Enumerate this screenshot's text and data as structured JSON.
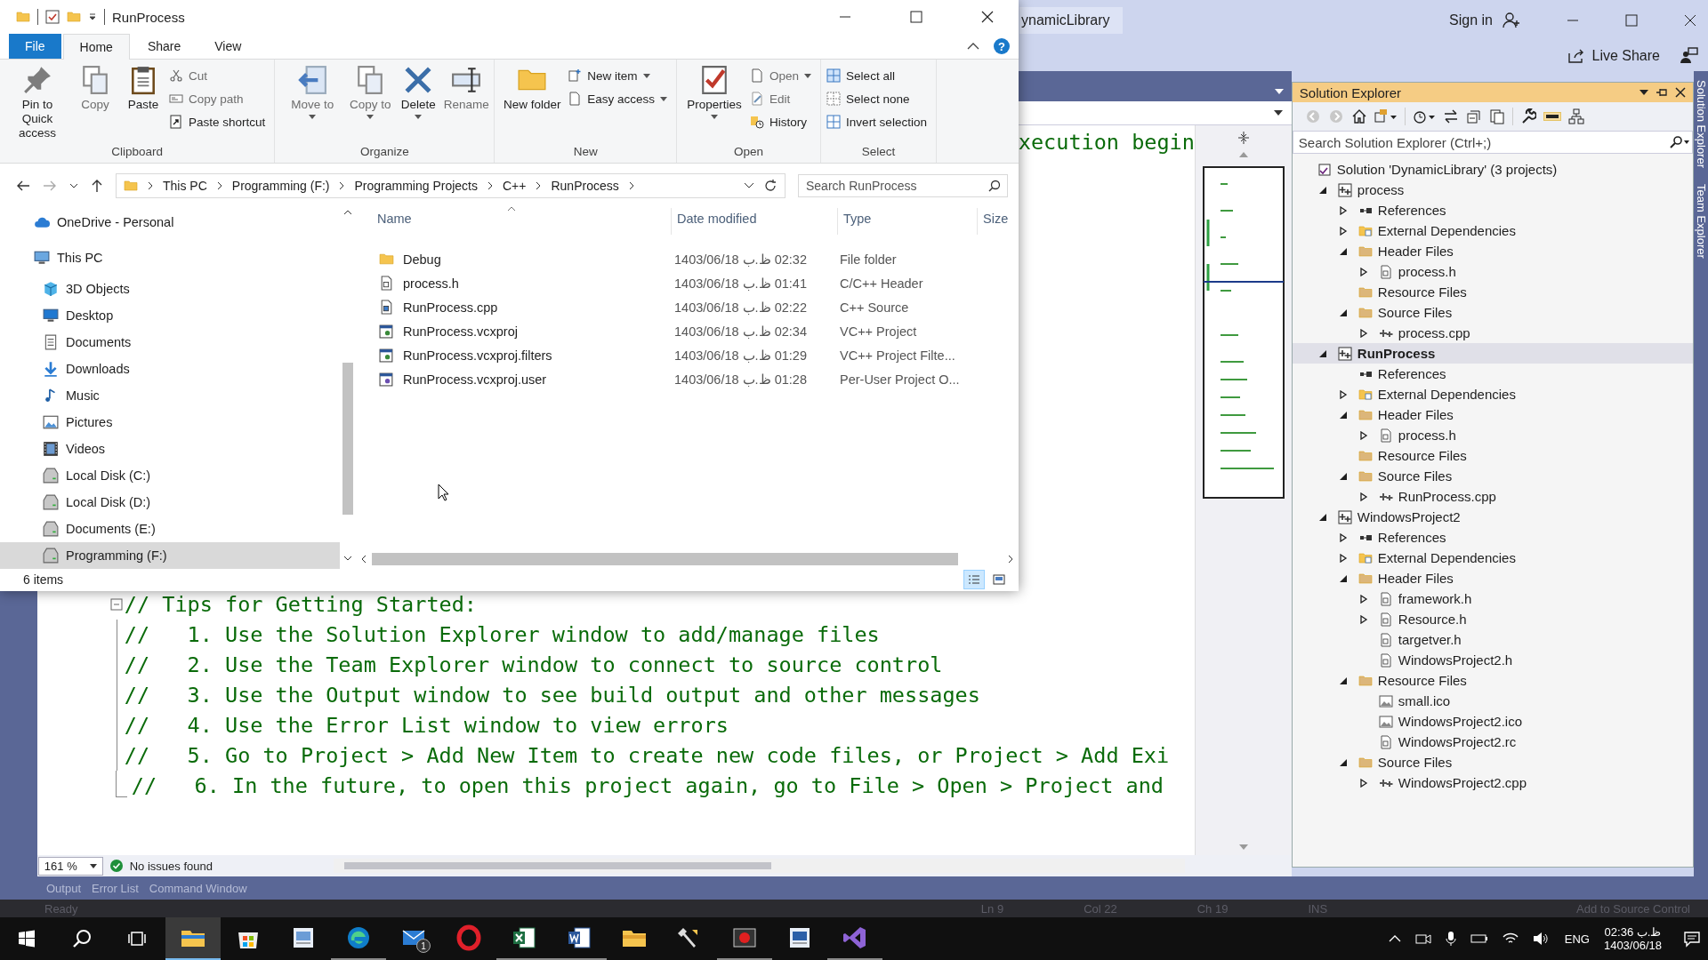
{
  "vs": {
    "title": "ynamicLibrary",
    "sign_in": "Sign in",
    "live_share": "Live Share",
    "editor": {
      "top_line": "xecution begin",
      "lines": [
        {
          "text": "// Tips for Getting Started:",
          "kind": "fold"
        },
        {
          "text": "//   1. Use the Solution Explorer window to add/manage files",
          "kind": "inner"
        },
        {
          "text": "//   2. Use the Team Explorer window to connect to source control",
          "kind": "inner"
        },
        {
          "text": "//   3. Use the Output window to see build output and other messages",
          "kind": "inner"
        },
        {
          "text": "//   4. Use the Error List window to view errors",
          "kind": "inner"
        },
        {
          "text": "//   5. Go to Project > Add New Item to create new code files, or Project > Add Exi",
          "kind": "inner"
        },
        {
          "text": "//   6. In the future, to open this project again, go to File > Open > Project and",
          "kind": "end"
        }
      ],
      "zoom": "161 %",
      "issues": "No issues found"
    },
    "solution_explorer": {
      "title": "Solution Explorer",
      "preview_toggle": {
        "on": true
      },
      "search": {
        "placeholder": "Search Solution Explorer (Ctrl+;)"
      },
      "tree": [
        {
          "label": "Solution 'DynamicLibrary' (3 projects)",
          "kind": "solution",
          "expandable": false,
          "selected": false,
          "children": [
            {
              "label": "process",
              "kind": "project",
              "expandable": true,
              "expanded": true,
              "selected": false,
              "children": [
                {
                  "label": "References",
                  "kind": "references",
                  "expandable": true,
                  "expanded": false,
                  "selected": false
                },
                {
                  "label": "External Dependencies",
                  "kind": "external",
                  "expandable": true,
                  "expanded": false,
                  "selected": false
                },
                {
                  "label": "Header Files",
                  "kind": "filter",
                  "expandable": true,
                  "expanded": true,
                  "selected": false,
                  "children": [
                    {
                      "label": "process.h",
                      "kind": "header",
                      "expandable": true,
                      "expanded": false,
                      "selected": false
                    }
                  ]
                },
                {
                  "label": "Resource Files",
                  "kind": "filter",
                  "expandable": false,
                  "selected": false
                },
                {
                  "label": "Source Files",
                  "kind": "filter",
                  "expandable": true,
                  "expanded": true,
                  "selected": false,
                  "children": [
                    {
                      "label": "process.cpp",
                      "kind": "source",
                      "expandable": true,
                      "expanded": false,
                      "selected": false
                    }
                  ]
                }
              ]
            },
            {
              "label": "RunProcess",
              "kind": "project",
              "expandable": true,
              "expanded": true,
              "selected": true,
              "children": [
                {
                  "label": "References",
                  "kind": "references",
                  "expandable": false,
                  "selected": false
                },
                {
                  "label": "External Dependencies",
                  "kind": "external",
                  "expandable": true,
                  "expanded": false,
                  "selected": false
                },
                {
                  "label": "Header Files",
                  "kind": "filter",
                  "expandable": true,
                  "expanded": true,
                  "selected": false,
                  "children": [
                    {
                      "label": "process.h",
                      "kind": "header",
                      "expandable": true,
                      "expanded": false,
                      "selected": false
                    }
                  ]
                },
                {
                  "label": "Resource Files",
                  "kind": "filter",
                  "expandable": false,
                  "selected": false
                },
                {
                  "label": "Source Files",
                  "kind": "filter",
                  "expandable": true,
                  "expanded": true,
                  "selected": false,
                  "children": [
                    {
                      "label": "RunProcess.cpp",
                      "kind": "source",
                      "expandable": true,
                      "expanded": false,
                      "selected": false
                    }
                  ]
                }
              ]
            },
            {
              "label": "WindowsProject2",
              "kind": "project",
              "expandable": true,
              "expanded": true,
              "selected": false,
              "children": [
                {
                  "label": "References",
                  "kind": "references",
                  "expandable": true,
                  "expanded": false,
                  "selected": false
                },
                {
                  "label": "External Dependencies",
                  "kind": "external",
                  "expandable": true,
                  "expanded": false,
                  "selected": false
                },
                {
                  "label": "Header Files",
                  "kind": "filter",
                  "expandable": true,
                  "expanded": true,
                  "selected": false,
                  "children": [
                    {
                      "label": "framework.h",
                      "kind": "header",
                      "expandable": true,
                      "expanded": false,
                      "selected": false
                    },
                    {
                      "label": "Resource.h",
                      "kind": "header",
                      "expandable": true,
                      "expanded": false,
                      "selected": false
                    },
                    {
                      "label": "targetver.h",
                      "kind": "header",
                      "expandable": false,
                      "selected": false
                    },
                    {
                      "label": "WindowsProject2.h",
                      "kind": "header",
                      "expandable": false,
                      "selected": false
                    }
                  ]
                },
                {
                  "label": "Resource Files",
                  "kind": "filter",
                  "expandable": true,
                  "expanded": true,
                  "selected": false,
                  "children": [
                    {
                      "label": "small.ico",
                      "kind": "image",
                      "expandable": false,
                      "selected": false
                    },
                    {
                      "label": "WindowsProject2.ico",
                      "kind": "image",
                      "expandable": false,
                      "selected": false
                    },
                    {
                      "label": "WindowsProject2.rc",
                      "kind": "resource",
                      "expandable": false,
                      "selected": false
                    }
                  ]
                },
                {
                  "label": "Source Files",
                  "kind": "filter",
                  "expandable": true,
                  "expanded": true,
                  "selected": false,
                  "children": [
                    {
                      "label": "WindowsProject2.cpp",
                      "kind": "source",
                      "expandable": true,
                      "expanded": false,
                      "selected": false
                    }
                  ]
                }
              ]
            }
          ]
        }
      ]
    },
    "side_tabs": [
      "Solution Explorer",
      "Team Explorer"
    ],
    "tool_tabs": [
      "Output",
      "Error List",
      "Command Window"
    ],
    "status_bar": {
      "state": "Ready",
      "line": "Ln 9",
      "col": "Col 22",
      "ch": "Ch 19",
      "mode": "INS",
      "source_control": "Add to Source Control"
    }
  },
  "explorer": {
    "title": "RunProcess",
    "help": "?",
    "ribbon_tabs": [
      {
        "label": "File",
        "kind": "file",
        "selected": false
      },
      {
        "label": "Home",
        "kind": "tab",
        "selected": true
      },
      {
        "label": "Share",
        "kind": "tab",
        "selected": false
      },
      {
        "label": "View",
        "kind": "tab",
        "selected": false
      }
    ],
    "ribbon_groups": [
      {
        "label": "Clipboard",
        "buttons": [
          {
            "label": "Pin to Quick access",
            "kind": "large",
            "disabled": false,
            "menu": false
          },
          {
            "label": "Copy",
            "kind": "large",
            "disabled": true,
            "menu": false
          },
          {
            "label": "Paste",
            "kind": "large",
            "disabled": false,
            "menu": false
          },
          {
            "label": "Cut",
            "kind": "small",
            "disabled": true,
            "menu": false
          },
          {
            "label": "Copy path",
            "kind": "small",
            "disabled": true,
            "menu": false
          },
          {
            "label": "Paste shortcut",
            "kind": "small",
            "disabled": false,
            "menu": false
          }
        ]
      },
      {
        "label": "Organize",
        "buttons": [
          {
            "label": "Move to",
            "kind": "large",
            "disabled": true,
            "menu": true
          },
          {
            "label": "Copy to",
            "kind": "large",
            "disabled": true,
            "menu": true
          },
          {
            "label": "Delete",
            "kind": "large",
            "disabled": false,
            "menu": true
          },
          {
            "label": "Rename",
            "kind": "large",
            "disabled": true,
            "menu": false
          }
        ]
      },
      {
        "label": "New",
        "buttons": [
          {
            "label": "New folder",
            "kind": "large",
            "disabled": false,
            "menu": false
          },
          {
            "label": "New item",
            "kind": "small",
            "disabled": false,
            "menu": true
          },
          {
            "label": "Easy access",
            "kind": "small",
            "disabled": false,
            "menu": true
          }
        ]
      },
      {
        "label": "Open",
        "buttons": [
          {
            "label": "Properties",
            "kind": "large",
            "disabled": false,
            "menu": true
          },
          {
            "label": "Open",
            "kind": "small",
            "disabled": true,
            "menu": true
          },
          {
            "label": "Edit",
            "kind": "small",
            "disabled": true,
            "menu": false
          },
          {
            "label": "History",
            "kind": "small",
            "disabled": false,
            "menu": false
          }
        ]
      },
      {
        "label": "Select",
        "buttons": [
          {
            "label": "Select all",
            "kind": "small",
            "disabled": false,
            "menu": false
          },
          {
            "label": "Select none",
            "kind": "small",
            "disabled": false,
            "menu": false
          },
          {
            "label": "Invert selection",
            "kind": "small",
            "disabled": false,
            "menu": false
          }
        ]
      }
    ],
    "breadcrumb": [
      "This PC",
      "Programming (F:)",
      "Programming Projects",
      "C++",
      "RunProcess"
    ],
    "search": {
      "placeholder": "Search RunProcess"
    },
    "nav": [
      {
        "label": "OneDrive - Personal",
        "kind": "cloud",
        "selected": false
      },
      {
        "label": "This PC",
        "kind": "pc",
        "selected": false,
        "children": [
          {
            "label": "3D Objects",
            "kind": "cube",
            "selected": false
          },
          {
            "label": "Desktop",
            "kind": "desktop",
            "selected": false
          },
          {
            "label": "Documents",
            "kind": "documents",
            "selected": false
          },
          {
            "label": "Downloads",
            "kind": "downloads",
            "selected": false
          },
          {
            "label": "Music",
            "kind": "music",
            "selected": false
          },
          {
            "label": "Pictures",
            "kind": "pictures",
            "selected": false
          },
          {
            "label": "Videos",
            "kind": "videos",
            "selected": false
          },
          {
            "label": "Local Disk (C:)",
            "kind": "drive",
            "selected": false
          },
          {
            "label": "Local Disk (D:)",
            "kind": "drive",
            "selected": false
          },
          {
            "label": "Documents (E:)",
            "kind": "drive",
            "selected": false
          },
          {
            "label": "Programming (F:)",
            "kind": "drive",
            "selected": true
          }
        ]
      }
    ],
    "columns": [
      "Name",
      "Date modified",
      "Type",
      "Size"
    ],
    "files": [
      {
        "name": "Debug",
        "kind": "folder",
        "date": "1403/06/18 ب.ظ 02:32",
        "type": "File folder"
      },
      {
        "name": "process.h",
        "kind": "header",
        "date": "1403/06/18 ب.ظ 01:41",
        "type": "C/C++ Header"
      },
      {
        "name": "RunProcess.cpp",
        "kind": "source",
        "date": "1403/06/18 ب.ظ 02:22",
        "type": "C++ Source"
      },
      {
        "name": "RunProcess.vcxproj",
        "kind": "project",
        "date": "1403/06/18 ب.ظ 02:34",
        "type": "VC++ Project"
      },
      {
        "name": "RunProcess.vcxproj.filters",
        "kind": "project",
        "date": "1403/06/18 ب.ظ 01:29",
        "type": "VC++ Project Filte..."
      },
      {
        "name": "RunProcess.vcxproj.user",
        "kind": "user",
        "date": "1403/06/18 ب.ظ 01:28",
        "type": "Per-User Project O..."
      }
    ],
    "status": "6 items",
    "views": [
      {
        "kind": "details",
        "selected": true
      },
      {
        "kind": "tiles",
        "selected": false
      }
    ]
  },
  "taskbar": {
    "apps": [
      {
        "kind": "explorer",
        "active": true,
        "running": true
      },
      {
        "kind": "store",
        "active": false,
        "running": false
      },
      {
        "kind": "viewer",
        "active": false,
        "running": false
      },
      {
        "kind": "browser",
        "active": false,
        "running": true
      },
      {
        "kind": "mail",
        "active": false,
        "running": false,
        "badge": "1"
      },
      {
        "kind": "opera",
        "active": false,
        "running": false
      },
      {
        "kind": "excel",
        "active": false,
        "running": true
      },
      {
        "kind": "word",
        "active": false,
        "running": true
      },
      {
        "kind": "folder",
        "active": false,
        "running": false
      },
      {
        "kind": "tools",
        "active": false,
        "running": false
      },
      {
        "kind": "recorder",
        "active": false,
        "running": true
      },
      {
        "kind": "calc",
        "active": false,
        "running": false
      },
      {
        "kind": "vs",
        "active": false,
        "running": true
      }
    ],
    "language": "ENG",
    "time": "02:36 ب.ظ",
    "date": "1403/06/18"
  }
}
